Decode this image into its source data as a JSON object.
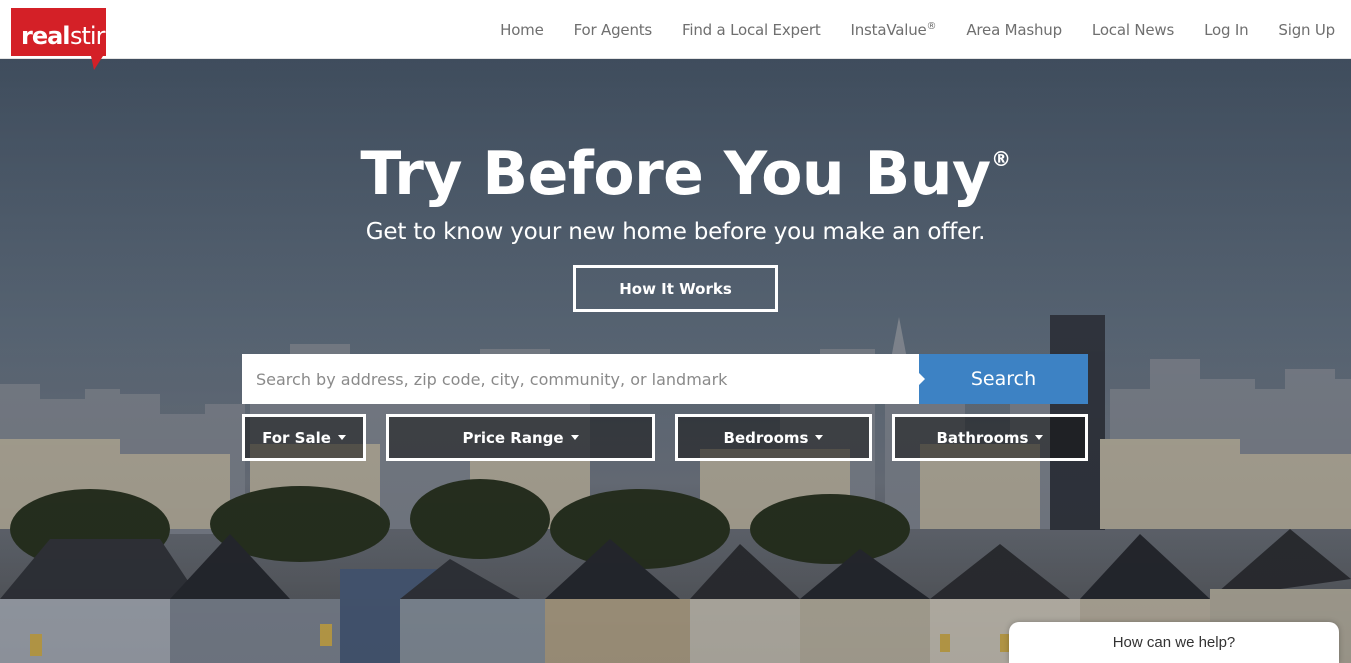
{
  "brand": {
    "logo_text": "realstir",
    "accent_color": "#d42027"
  },
  "nav": {
    "items": [
      {
        "label": "Home"
      },
      {
        "label": "For Agents"
      },
      {
        "label": "Find a Local Expert"
      },
      {
        "label": "InstaValue",
        "sup": "®"
      },
      {
        "label": "Area Mashup"
      },
      {
        "label": "Local News"
      },
      {
        "label": "Log In"
      },
      {
        "label": "Sign Up"
      }
    ]
  },
  "hero": {
    "title": "Try Before You Buy",
    "title_mark": "®",
    "subtitle": "Get to know your new home before you make an offer.",
    "how_it_works_label": "How It Works"
  },
  "search": {
    "placeholder": "Search by address, zip code, city, community, or landmark",
    "value": "",
    "button_label": "Search",
    "button_color": "#3d82c4"
  },
  "filters": {
    "for_sale": "For Sale",
    "price_range": "Price Range",
    "bedrooms": "Bedrooms",
    "bathrooms": "Bathrooms"
  },
  "chat": {
    "label": "How can we help?"
  }
}
